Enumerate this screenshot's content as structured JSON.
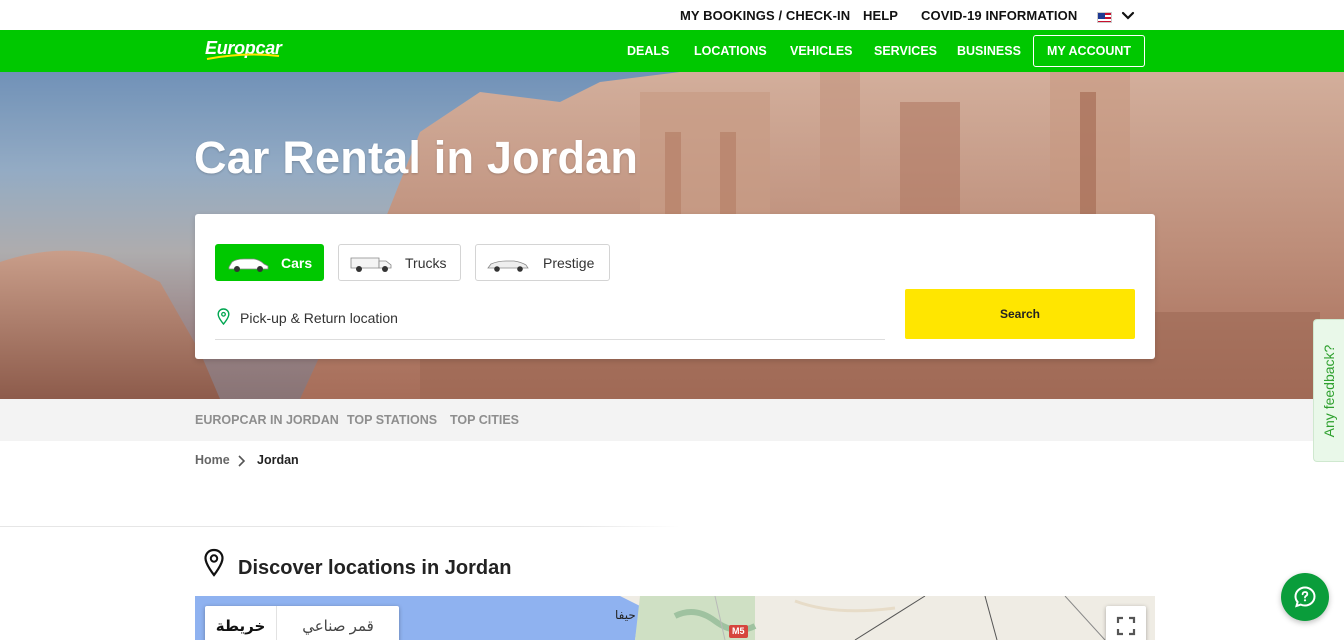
{
  "utility_nav": {
    "my_bookings": "MY BOOKINGS / CHECK-IN",
    "help": "HELP",
    "covid": "COVID-19 INFORMATION",
    "language_icon": "us-flag-icon"
  },
  "brand": {
    "logo": "Europcar",
    "primary_color": "#00c800",
    "search_color": "#ffe600"
  },
  "main_nav": {
    "items": [
      "DEALS",
      "LOCATIONS",
      "VEHICLES",
      "SERVICES",
      "BUSINESS"
    ],
    "account": "MY ACCOUNT"
  },
  "hero": {
    "title": "Car Rental in Jordan"
  },
  "search": {
    "tabs": [
      {
        "label": "Cars",
        "icon": "car-icon",
        "active": true
      },
      {
        "label": "Trucks",
        "icon": "truck-icon",
        "active": false
      },
      {
        "label": "Prestige",
        "icon": "prestige-car-icon",
        "active": false
      }
    ],
    "location_placeholder": "Pick-up & Return location",
    "button": "Search"
  },
  "anchors": [
    "EUROPCAR IN JORDAN",
    "TOP STATIONS",
    "TOP CITIES"
  ],
  "breadcrumb": {
    "home": "Home",
    "current": "Jordan"
  },
  "discover": {
    "title": "Discover locations in Jordan"
  },
  "map": {
    "type_map": "خريطة",
    "type_satellite": "قمر صناعي",
    "city": "حيفا",
    "road": "M5"
  },
  "feedback": "Any feedback?"
}
